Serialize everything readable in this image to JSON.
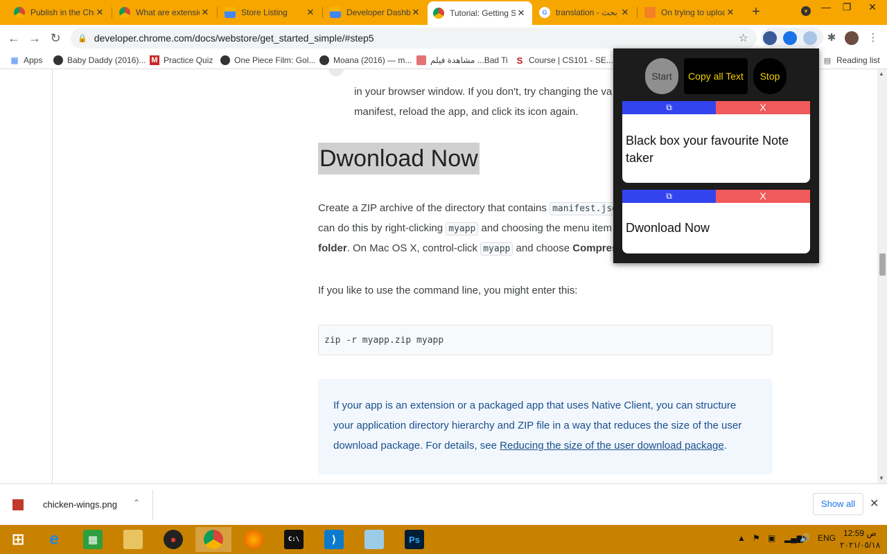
{
  "tabs": [
    {
      "title": "Publish in the Chro",
      "icon": "chrome-icon"
    },
    {
      "title": "What are extensio",
      "icon": "chrome-icon"
    },
    {
      "title": "Store Listing",
      "icon": "webstore-icon"
    },
    {
      "title": "Developer Dashbo",
      "icon": "webstore-icon"
    },
    {
      "title": "Tutorial: Getting S",
      "icon": "chrome-icon",
      "active": true
    },
    {
      "title": "translation - بحث G",
      "icon": "google-icon"
    },
    {
      "title": "On trying to uploa",
      "icon": "stackoverflow-icon"
    }
  ],
  "tab_close_label": "✕",
  "new_tab_label": "+",
  "window_controls": {
    "minimize": "—",
    "restore": "❐",
    "close": "✕"
  },
  "toolbar": {
    "back": "←",
    "forward": "→",
    "reload": "↻",
    "url": "developer.chrome.com/docs/webstore/get_started_simple/#step5",
    "star": "☆"
  },
  "bookmarks": [
    {
      "label": "Apps"
    },
    {
      "label": "Baby Daddy (2016)..."
    },
    {
      "label": "Practice Quiz"
    },
    {
      "label": "One Piece Film: Gol..."
    },
    {
      "label": "Moana (2016) — m..."
    },
    {
      "label": "مشاهدة فيلم ...Bad Ti"
    },
    {
      "label": "Course | CS101 - SE..."
    }
  ],
  "reading_list": "Reading list",
  "page": {
    "top_para_line1": "in your browser window. If you don't, try changing the va",
    "top_para_line2": "manifest, reload the app, and click its icon again.",
    "heading": "Dwonload Now",
    "zip_p1_a": "Create a ZIP archive of the directory that contains ",
    "zip_p1_code": "manifest.jso",
    "zip_p2_a": "can do this by right-clicking ",
    "zip_p2_code": "myapp",
    "zip_p2_b": " and choosing the menu item",
    "zip_p3_bold": "folder",
    "zip_p3_a": ". On Mac OS X, control-click ",
    "zip_p3_code": "myapp",
    "zip_p3_b": " and choose ",
    "zip_p3_bold2": "Compress",
    "cmdline": "If you like to use the command line, you might enter this:",
    "code": "zip -r myapp.zip myapp",
    "note_text": "If your app is an extension or a packaged app that uses Native Client, you can structure your application directory hierarchy and ZIP file in a way that reduces the size of the user download package. For details, see ",
    "note_link": "Reducing the size of the user download package",
    "note_end": "."
  },
  "popup": {
    "start": "Start",
    "copy_all": "Copy all Text",
    "stop": "Stop",
    "cards": [
      {
        "copy": "⧉",
        "delete": "X",
        "text": "Black box your favourite Note taker"
      },
      {
        "copy": "⧉",
        "delete": "X",
        "text": "Dwonload Now"
      }
    ]
  },
  "download": {
    "filename": "chicken-wings.png",
    "chevron": "⌃",
    "show_all": "Show all",
    "close": "✕"
  },
  "taskbar": {
    "apps": [
      {
        "name": "start-icon"
      },
      {
        "name": "internet-explorer-icon"
      },
      {
        "name": "store-icon"
      },
      {
        "name": "file-explorer-icon"
      },
      {
        "name": "app-red-icon"
      },
      {
        "name": "chrome-icon"
      },
      {
        "name": "firefox-icon"
      },
      {
        "name": "terminal-icon"
      },
      {
        "name": "vscode-icon"
      },
      {
        "name": "notepad-icon"
      },
      {
        "name": "photoshop-icon"
      }
    ],
    "language": "ENG",
    "time": "12:59 ص",
    "date": "٢٠٢١/٠٥/١٨"
  },
  "colors": {
    "tabstrip": "#f7a600",
    "taskbar": "#c98200",
    "popup_bg": "#1c1c1c",
    "popup_accent": "#f5d000",
    "copy_bar": "#3344ee",
    "delete_bar": "#f05a5a"
  }
}
